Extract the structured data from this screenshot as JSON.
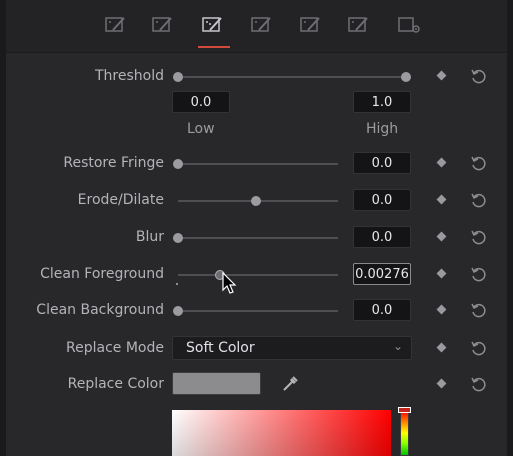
{
  "toolbar": {
    "tools": [
      {
        "icon": "qualifier-tool-1-icon"
      },
      {
        "icon": "qualifier-tool-2-icon"
      },
      {
        "icon": "qualifier-tool-3-icon",
        "active": true
      },
      {
        "icon": "qualifier-tool-4-icon"
      },
      {
        "icon": "qualifier-tool-5-icon"
      },
      {
        "icon": "qualifier-tool-6-icon"
      },
      {
        "icon": "settings-tool-icon"
      }
    ],
    "accent": "#d34a3c"
  },
  "threshold": {
    "label": "Threshold",
    "low_value": "0.0",
    "high_value": "1.0",
    "low_label": "Low",
    "high_label": "High",
    "low_pos": 0.0,
    "high_pos": 1.0
  },
  "restore_fringe": {
    "label": "Restore Fringe",
    "value": "0.0",
    "pos": 0.0
  },
  "erode_dilate": {
    "label": "Erode/Dilate",
    "value": "0.0",
    "pos": 0.5
  },
  "blur": {
    "label": "Blur",
    "value": "0.0",
    "pos": 0.0
  },
  "clean_foreground": {
    "label": "Clean Foreground",
    "value": "0.00276",
    "pos": 0.28
  },
  "clean_background": {
    "label": "Clean Background",
    "value": "0.0",
    "pos": 0.0
  },
  "replace_mode": {
    "label": "Replace Mode",
    "value": "Soft Color"
  },
  "replace_color": {
    "label": "Replace Color",
    "swatch_color": "#8c8c8e"
  },
  "colors": {
    "background": "#28282b",
    "field": "#141416",
    "track": "#4f4f53",
    "thumb": "#9c9ca0"
  }
}
